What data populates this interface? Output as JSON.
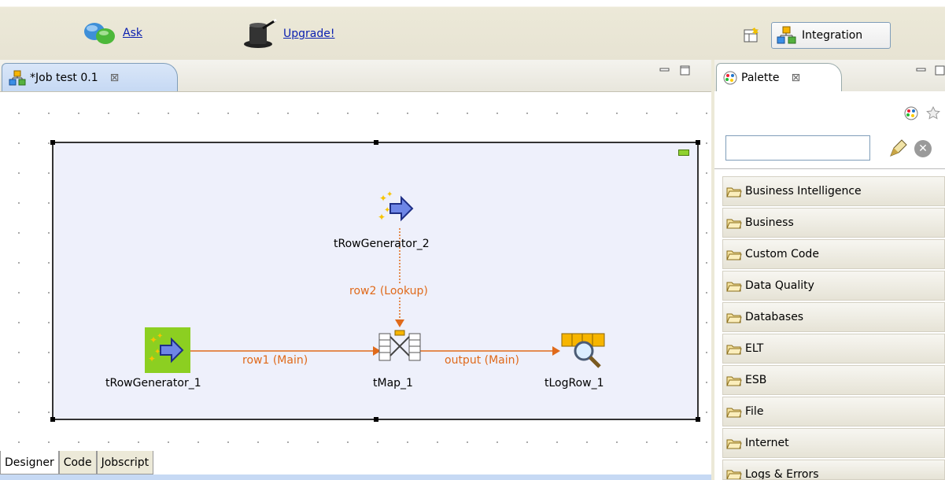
{
  "toolbar": {
    "ask_label": "Ask",
    "upgrade_label": "Upgrade!",
    "perspective_label": "Integration"
  },
  "editor": {
    "tab_title": "*Job test 0.1",
    "components": {
      "gen1": "tRowGenerator_1",
      "gen2": "tRowGenerator_2",
      "map": "tMap_1",
      "log": "tLogRow_1"
    },
    "connections": {
      "row1": "row1 (Main)",
      "row2": "row2 (Lookup)",
      "output": "output (Main)"
    },
    "bottom_tabs": [
      "Designer",
      "Code",
      "Jobscript"
    ]
  },
  "palette": {
    "tab_title": "Palette",
    "search_value": "",
    "categories": [
      "Business Intelligence",
      "Business",
      "Custom Code",
      "Data Quality",
      "Databases",
      "ELT",
      "ESB",
      "File",
      "Internet",
      "Logs & Errors"
    ]
  },
  "colors": {
    "connection": "#e06a1b",
    "subjob_fill": "#eef0fb",
    "link": "#0a1fb0"
  }
}
